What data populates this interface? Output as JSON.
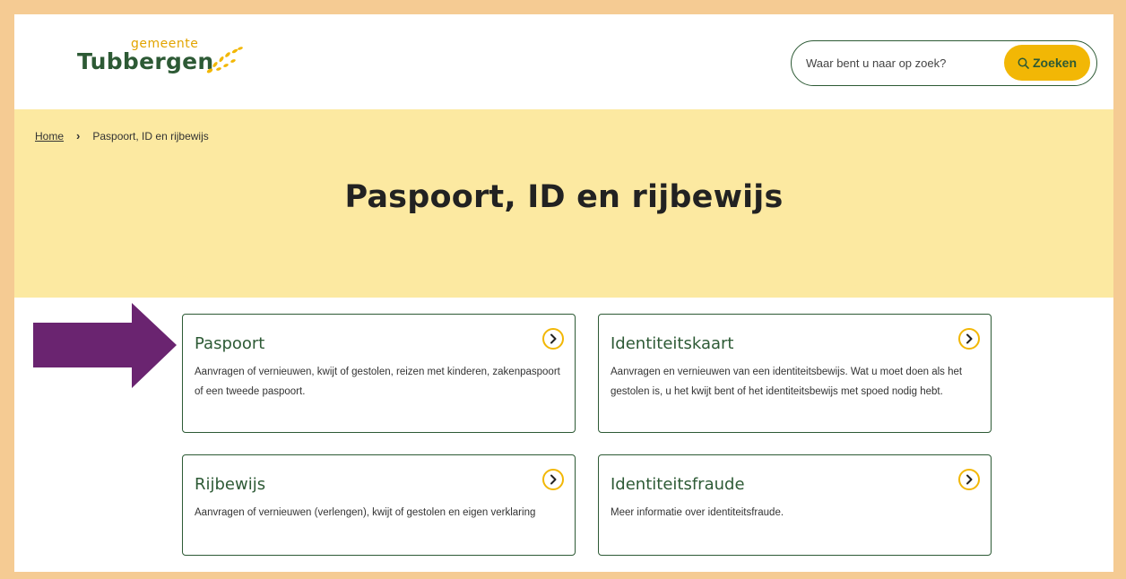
{
  "header": {
    "logo": {
      "small": "gemeente",
      "big": "Tubbergen"
    },
    "search": {
      "placeholder": "Waar bent u naar op zoek?",
      "button_label": "Zoeken"
    }
  },
  "breadcrumb": {
    "home": "Home",
    "current": "Paspoort, ID en rijbewijs"
  },
  "page": {
    "title": "Paspoort, ID en rijbewijs"
  },
  "cards": [
    {
      "title": "Paspoort",
      "description": "Aanvragen of vernieuwen, kwijt of gestolen, reizen met kinderen, zakenpaspoort of een tweede paspoort."
    },
    {
      "title": "Identiteitskaart",
      "description": "Aanvragen en vernieuwen van een identiteitsbewijs. Wat u moet doen als het gestolen is, u het kwijt bent of het identiteitsbewijs met spoed nodig hebt."
    },
    {
      "title": "Rijbewijs",
      "description": "Aanvragen of vernieuwen (verlengen), kwijt of gestolen en eigen verklaring"
    },
    {
      "title": "Identiteitsfraude",
      "description": "Meer informatie over identiteitsfraude."
    }
  ],
  "colors": {
    "brand_green": "#2d5a35",
    "accent_yellow": "#f2b705",
    "hero_bg": "#fce9a1",
    "annotation_arrow": "#6a2470",
    "frame": "#f5cb93"
  }
}
